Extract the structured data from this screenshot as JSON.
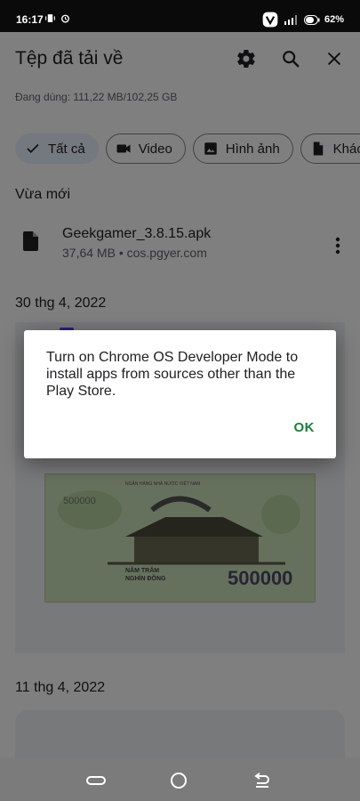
{
  "status_bar": {
    "time": "16:17",
    "battery": "62",
    "battery_unit": "%"
  },
  "app": {
    "title": "Tệp đã tải về",
    "storage": "Đang dùng: 111,22 MB/102,25 GB"
  },
  "filters": {
    "all": "Tất cả",
    "video": "Video",
    "images": "Hình ảnh",
    "other": "Khác"
  },
  "sections": {
    "recent": "Vừa mới",
    "date_1": "30 thg 4, 2022",
    "date_2": "11 thg 4, 2022"
  },
  "file": {
    "name": "Geekgamer_3.8.15.apk",
    "meta": "37,64 MB • cos.pgyer.com"
  },
  "banknote": {
    "bank_name": "NGÂN HÀNG NHÀ NƯỚC VIỆT NAM",
    "value": "500000",
    "words_line1": "NĂM TRĂM",
    "words_line2": "NGHÌN ĐỒNG"
  },
  "dialog": {
    "message": "Turn on Chrome OS Developer Mode to install apps from sources other than the Play Store.",
    "ok": "OK"
  },
  "colors": {
    "accent": "#188038",
    "chip_selected": "#e8f0fe",
    "scrim": "rgba(0,0,0,0.5)"
  },
  "icons": [
    "settings-icon",
    "search-icon",
    "close-icon",
    "check-icon",
    "video-icon",
    "image-icon",
    "document-icon",
    "more-vert-icon",
    "home-icon",
    "back-icon",
    "recents-icon"
  ]
}
